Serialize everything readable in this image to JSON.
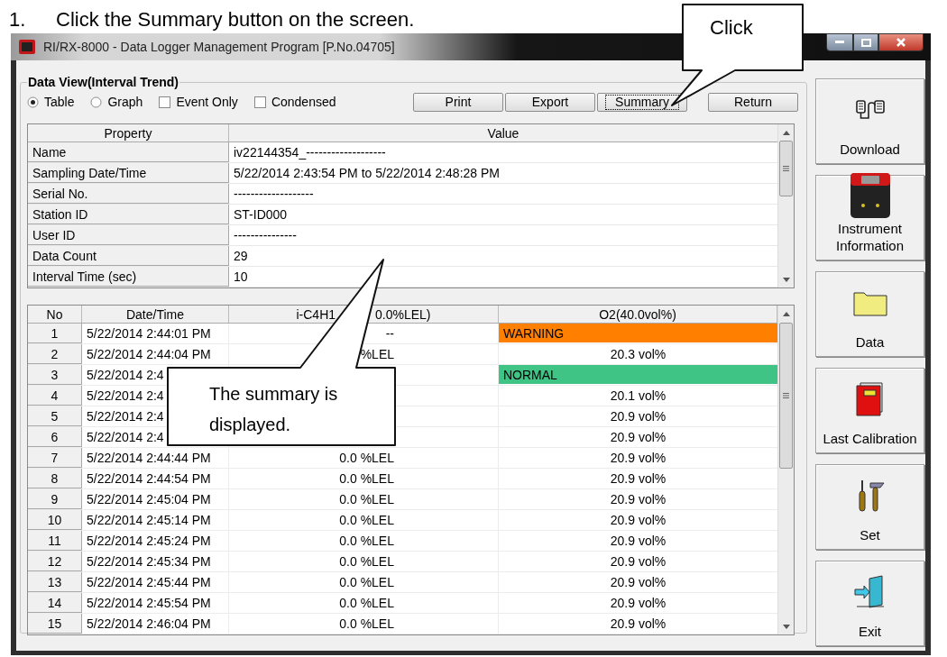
{
  "instruction": {
    "number": "1.",
    "text": "Click the Summary button on the screen."
  },
  "window": {
    "title": "RI/RX-8000  - Data Logger Management Program [P.No.04705]"
  },
  "group": {
    "title": "Data View(Interval Trend)"
  },
  "view_options": [
    {
      "kind": "radio",
      "label": "Table",
      "selected": true
    },
    {
      "kind": "radio",
      "label": "Graph",
      "selected": false
    },
    {
      "kind": "checkbox",
      "label": "Event Only",
      "checked": false
    },
    {
      "kind": "checkbox",
      "label": "Condensed",
      "checked": false
    }
  ],
  "toolbar_buttons": [
    {
      "label": "Print",
      "focused": false
    },
    {
      "label": "Export",
      "focused": false
    },
    {
      "label": "Summary",
      "focused": true
    },
    {
      "label": "Return",
      "focused": false
    }
  ],
  "properties_table": {
    "columns": [
      "Property",
      "Value"
    ],
    "rows": [
      [
        "Name",
        "iv22144354_-------------------"
      ],
      [
        "Sampling Date/Time",
        "5/22/2014 2:43:54 PM to 5/22/2014 2:48:28 PM"
      ],
      [
        "Serial No.",
        "-------------------"
      ],
      [
        "Station ID",
        "ST-ID000"
      ],
      [
        "User ID",
        "---------------"
      ],
      [
        "Data Count",
        "29"
      ],
      [
        "Interval Time (sec)",
        "10"
      ]
    ]
  },
  "data_table": {
    "columns": [
      {
        "parts": [
          "No"
        ]
      },
      {
        "parts": [
          "Date/Time"
        ]
      },
      {
        "parts": [
          "i-C4H1",
          "0.0%LEL)"
        ]
      },
      {
        "parts": [
          "O2(40.0vol%)"
        ]
      }
    ],
    "rows": [
      {
        "no": "1",
        "datetime": "5/22/2014 2:44:01 PM",
        "gas": "--",
        "o2": {
          "text": "WARNING",
          "color": "#ff8000"
        }
      },
      {
        "no": "2",
        "datetime": "5/22/2014 2:44:04 PM",
        "gas": "%LEL",
        "o2": "20.3 vol%"
      },
      {
        "no": "3",
        "datetime": "5/22/2014 2:4",
        "o2": {
          "text": "NORMAL",
          "color": "#40c486"
        }
      },
      {
        "no": "4",
        "datetime": "5/22/2014 2:4",
        "o2": "20.1 vol%"
      },
      {
        "no": "5",
        "datetime": "5/22/2014 2:4",
        "o2": "20.9 vol%"
      },
      {
        "no": "6",
        "datetime": "5/22/2014 2:4",
        "o2": "20.9 vol%"
      },
      {
        "no": "7",
        "datetime": "5/22/2014 2:44:44 PM",
        "gas": "0.0 %LEL",
        "o2": "20.9 vol%"
      },
      {
        "no": "8",
        "datetime": "5/22/2014 2:44:54 PM",
        "gas": "0.0 %LEL",
        "o2": "20.9 vol%"
      },
      {
        "no": "9",
        "datetime": "5/22/2014 2:45:04 PM",
        "gas": "0.0 %LEL",
        "o2": "20.9 vol%"
      },
      {
        "no": "10",
        "datetime": "5/22/2014 2:45:14 PM",
        "gas": "0.0 %LEL",
        "o2": "20.9 vol%"
      },
      {
        "no": "11",
        "datetime": "5/22/2014 2:45:24 PM",
        "gas": "0.0 %LEL",
        "o2": "20.9 vol%"
      },
      {
        "no": "12",
        "datetime": "5/22/2014 2:45:34 PM",
        "gas": "0.0 %LEL",
        "o2": "20.9 vol%"
      },
      {
        "no": "13",
        "datetime": "5/22/2014 2:45:44 PM",
        "gas": "0.0 %LEL",
        "o2": "20.9 vol%"
      },
      {
        "no": "14",
        "datetime": "5/22/2014 2:45:54 PM",
        "gas": "0.0 %LEL",
        "o2": "20.9 vol%"
      },
      {
        "no": "15",
        "datetime": "5/22/2014 2:46:04 PM",
        "gas": "0.0 %LEL",
        "o2": "20.9 vol%"
      }
    ]
  },
  "sidebar_buttons": [
    {
      "kind": "download",
      "label": "Download"
    },
    {
      "kind": "instrument",
      "label": "Instrument Information"
    },
    {
      "kind": "data",
      "label": "Data"
    },
    {
      "kind": "calibration",
      "label": "Last Calibration"
    },
    {
      "kind": "set",
      "label": "Set"
    },
    {
      "kind": "exit",
      "label": "Exit"
    }
  ],
  "callouts": [
    {
      "kind": "click",
      "text": "Click"
    },
    {
      "kind": "summary",
      "text": "The summary is displayed."
    }
  ]
}
